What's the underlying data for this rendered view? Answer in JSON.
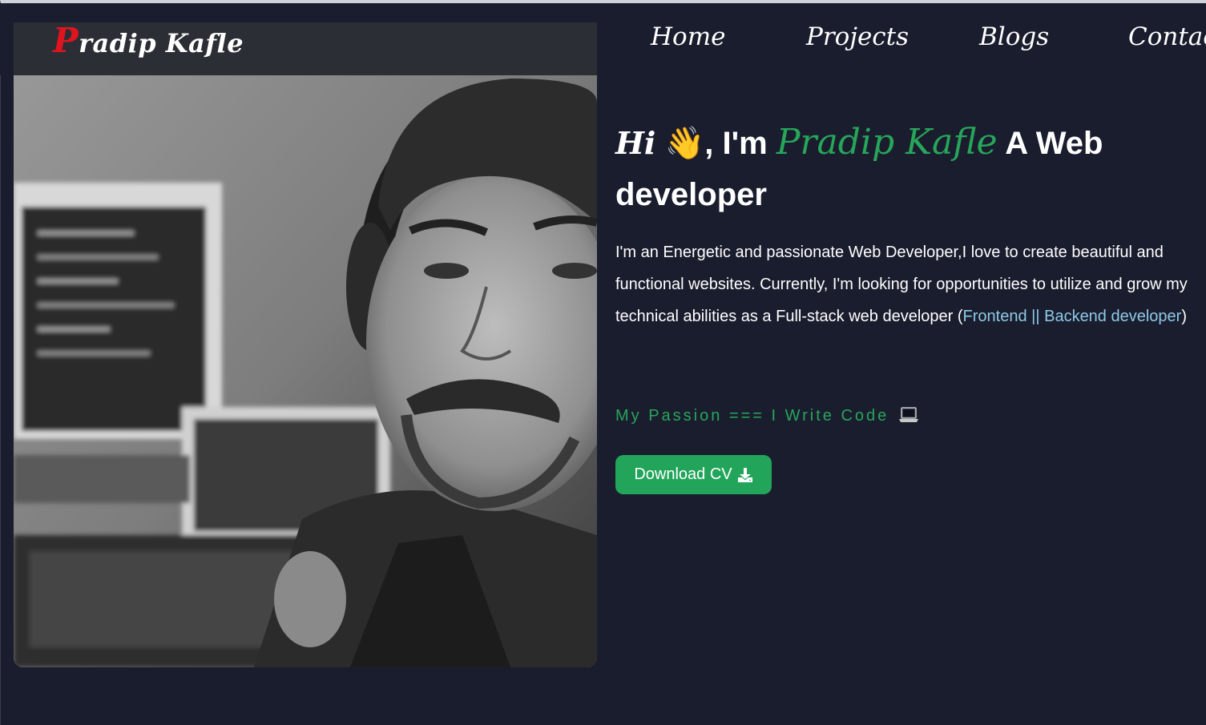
{
  "navbar": {
    "brand_first": "P",
    "brand_rest": "radip Kafle",
    "links": [
      "Home",
      "Projects",
      "Blogs",
      "Contact"
    ]
  },
  "hero": {
    "greeting": "Hi",
    "wave": "👋",
    "intro": ", I'm",
    "name": "Pradip Kafle",
    "role": "A Web developer",
    "description": "I'm an Energetic and passionate Web Developer,I love to create beautiful and functional websites. Currently, I'm looking for opportunities to utilize and grow my technical abilities as a Full-stack web developer (",
    "role_link": "Frontend || Backend developer",
    "description_end": ")",
    "passion": "My Passion === I Write Code",
    "cv_button": "Download CV"
  },
  "icons": {
    "download": "download-icon",
    "laptop": "laptop-icon",
    "wave": "waving-hand-icon"
  },
  "colors": {
    "background": "#1a1d2e",
    "accent_green": "#27a65a",
    "brand_red": "#e0141e",
    "link_blue": "#8ecae6"
  }
}
